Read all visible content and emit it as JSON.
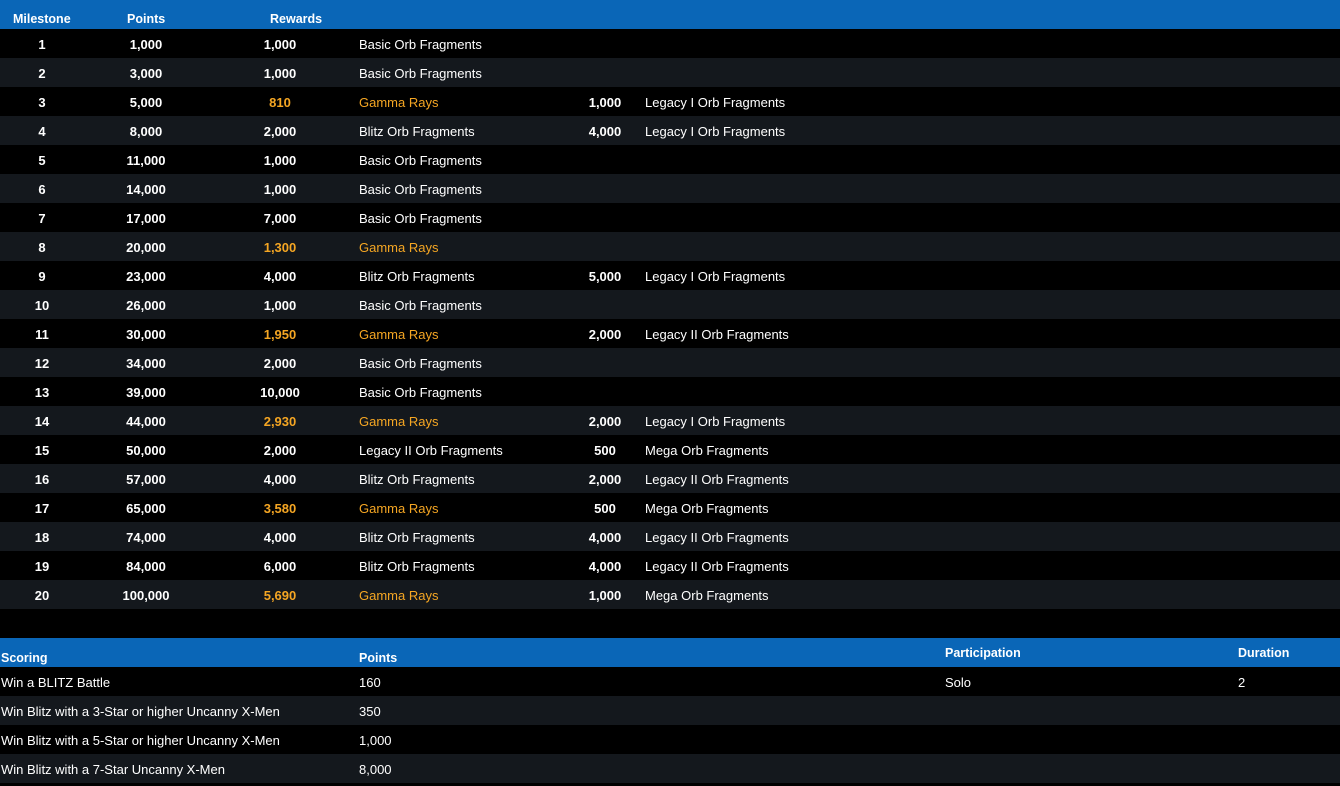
{
  "milestones": {
    "headers": {
      "milestone": "Milestone",
      "points": "Points",
      "rewards": "Rewards"
    },
    "rows": [
      {
        "num": "1",
        "points": "1,000",
        "r1v": "1,000",
        "r1n": "Basic Orb Fragments",
        "r2v": "",
        "r2n": "",
        "gamma": false
      },
      {
        "num": "2",
        "points": "3,000",
        "r1v": "1,000",
        "r1n": "Basic Orb Fragments",
        "r2v": "",
        "r2n": "",
        "gamma": false
      },
      {
        "num": "3",
        "points": "5,000",
        "r1v": "810",
        "r1n": "Gamma Rays",
        "r2v": "1,000",
        "r2n": "Legacy I Orb Fragments",
        "gamma": true
      },
      {
        "num": "4",
        "points": "8,000",
        "r1v": "2,000",
        "r1n": "Blitz Orb Fragments",
        "r2v": "4,000",
        "r2n": "Legacy I Orb Fragments",
        "gamma": false
      },
      {
        "num": "5",
        "points": "11,000",
        "r1v": "1,000",
        "r1n": "Basic Orb Fragments",
        "r2v": "",
        "r2n": "",
        "gamma": false
      },
      {
        "num": "6",
        "points": "14,000",
        "r1v": "1,000",
        "r1n": "Basic Orb Fragments",
        "r2v": "",
        "r2n": "",
        "gamma": false
      },
      {
        "num": "7",
        "points": "17,000",
        "r1v": "7,000",
        "r1n": "Basic Orb Fragments",
        "r2v": "",
        "r2n": "",
        "gamma": false
      },
      {
        "num": "8",
        "points": "20,000",
        "r1v": "1,300",
        "r1n": "Gamma Rays",
        "r2v": "",
        "r2n": "",
        "gamma": true
      },
      {
        "num": "9",
        "points": "23,000",
        "r1v": "4,000",
        "r1n": "Blitz Orb Fragments",
        "r2v": "5,000",
        "r2n": "Legacy I Orb Fragments",
        "gamma": false
      },
      {
        "num": "10",
        "points": "26,000",
        "r1v": "1,000",
        "r1n": "Basic Orb Fragments",
        "r2v": "",
        "r2n": "",
        "gamma": false
      },
      {
        "num": "11",
        "points": "30,000",
        "r1v": "1,950",
        "r1n": "Gamma Rays",
        "r2v": "2,000",
        "r2n": "Legacy II Orb Fragments",
        "gamma": true
      },
      {
        "num": "12",
        "points": "34,000",
        "r1v": "2,000",
        "r1n": "Basic Orb Fragments",
        "r2v": "",
        "r2n": "",
        "gamma": false
      },
      {
        "num": "13",
        "points": "39,000",
        "r1v": "10,000",
        "r1n": "Basic Orb Fragments",
        "r2v": "",
        "r2n": "",
        "gamma": false
      },
      {
        "num": "14",
        "points": "44,000",
        "r1v": "2,930",
        "r1n": "Gamma Rays",
        "r2v": "2,000",
        "r2n": "Legacy I Orb Fragments",
        "gamma": true
      },
      {
        "num": "15",
        "points": "50,000",
        "r1v": "2,000",
        "r1n": "Legacy II Orb Fragments",
        "r2v": "500",
        "r2n": "Mega Orb Fragments",
        "gamma": false
      },
      {
        "num": "16",
        "points": "57,000",
        "r1v": "4,000",
        "r1n": "Blitz Orb Fragments",
        "r2v": "2,000",
        "r2n": "Legacy II Orb Fragments",
        "gamma": false
      },
      {
        "num": "17",
        "points": "65,000",
        "r1v": "3,580",
        "r1n": "Gamma Rays",
        "r2v": "500",
        "r2n": "Mega Orb Fragments",
        "gamma": true
      },
      {
        "num": "18",
        "points": "74,000",
        "r1v": "4,000",
        "r1n": "Blitz Orb Fragments",
        "r2v": "4,000",
        "r2n": "Legacy II Orb Fragments",
        "gamma": false
      },
      {
        "num": "19",
        "points": "84,000",
        "r1v": "6,000",
        "r1n": "Blitz Orb Fragments",
        "r2v": "4,000",
        "r2n": "Legacy II Orb Fragments",
        "gamma": false
      },
      {
        "num": "20",
        "points": "100,000",
        "r1v": "5,690",
        "r1n": "Gamma Rays",
        "r2v": "1,000",
        "r2n": "Mega Orb Fragments",
        "gamma": true
      }
    ]
  },
  "scoring": {
    "headers": {
      "scoring": "Scoring",
      "points": "Points",
      "participation": "Participation",
      "duration": "Duration"
    },
    "rows": [
      {
        "name": "Win a BLITZ Battle",
        "points": "160",
        "participation": "Solo",
        "duration": "2"
      },
      {
        "name": "Win Blitz with a 3-Star or higher Uncanny X-Men",
        "points": "350",
        "participation": "",
        "duration": ""
      },
      {
        "name": "Win Blitz with a 5-Star or higher Uncanny X-Men",
        "points": "1,000",
        "participation": "",
        "duration": ""
      },
      {
        "name": "Win Blitz with a 7-Star Uncanny X-Men",
        "points": "8,000",
        "participation": "",
        "duration": ""
      }
    ]
  },
  "colors": {
    "header_bg": "#0a66b7",
    "row_alt_bg": "#14181d",
    "gamma_highlight": "#f5a623"
  }
}
